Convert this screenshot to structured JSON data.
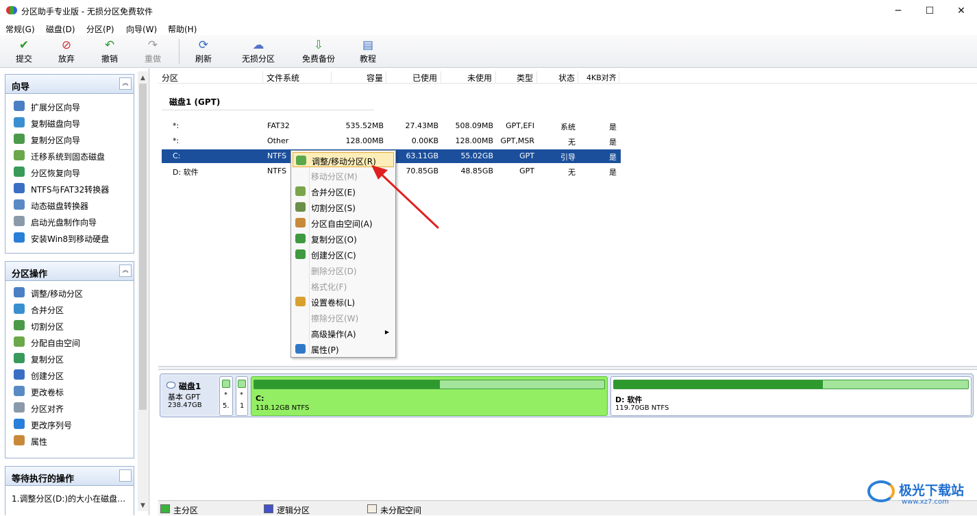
{
  "window": {
    "title": "分区助手专业版 - 无损分区免费软件",
    "controls": {
      "minimize": "─",
      "maximize": "☐",
      "close": "✕"
    }
  },
  "menu": [
    "常规(G)",
    "磁盘(D)",
    "分区(P)",
    "向导(W)",
    "帮助(H)"
  ],
  "toolbar": [
    {
      "label": "提交",
      "icon": "check-icon",
      "glyph": "✔",
      "color": "#2b9a2b"
    },
    {
      "label": "放弃",
      "icon": "discard-icon",
      "glyph": "⊘",
      "color": "#d23030"
    },
    {
      "label": "撤销",
      "icon": "undo-icon",
      "glyph": "↶",
      "color": "#2b9a2b"
    },
    {
      "label": "重做",
      "icon": "redo-icon",
      "glyph": "↷",
      "color": "#9a9a9a"
    },
    {
      "label": "刷新",
      "icon": "refresh-icon",
      "glyph": "⟳",
      "color": "#3a6fc4"
    },
    {
      "label": "无损分区",
      "icon": "lossless-partition-icon",
      "glyph": "☁",
      "color": "#5572c8"
    },
    {
      "label": "免费备份",
      "icon": "backup-icon",
      "glyph": "⇩",
      "color": "#2b9a2b"
    },
    {
      "label": "教程",
      "icon": "tutorial-icon",
      "glyph": "▤",
      "color": "#3a6fc4"
    }
  ],
  "wizard_panel": {
    "title": "向导",
    "items": [
      "扩展分区向导",
      "复制磁盘向导",
      "复制分区向导",
      "迁移系统到固态磁盘",
      "分区恢复向导",
      "NTFS与FAT32转换器",
      "动态磁盘转换器",
      "启动光盘制作向导",
      "安装Win8到移动硬盘"
    ]
  },
  "ops_panel": {
    "title": "分区操作",
    "items": [
      "调整/移动分区",
      "合并分区",
      "切割分区",
      "分配自由空间",
      "复制分区",
      "创建分区",
      "更改卷标",
      "分区对齐",
      "更改序列号",
      "属性"
    ]
  },
  "pending_panel": {
    "title": "等待执行的操作",
    "items": [
      "1.调整分区(D:)的大小在磁盘…"
    ]
  },
  "columns": [
    "分区",
    "文件系统",
    "容量",
    "已使用",
    "未使用",
    "类型",
    "状态",
    "4KB对齐"
  ],
  "disk_label": "磁盘1 (GPT)",
  "rows": [
    {
      "name": "*:",
      "fs": "FAT32",
      "cap": "535.52MB",
      "used": "27.43MB",
      "free": "508.09MB",
      "type": "GPT,EFI",
      "status": "系统",
      "align": "是"
    },
    {
      "name": "*:",
      "fs": "Other",
      "cap": "128.00MB",
      "used": "0.00KB",
      "free": "128.00MB",
      "type": "GPT,MSR",
      "status": "无",
      "align": "是"
    },
    {
      "name": "C:",
      "fs": "NTFS",
      "cap": "",
      "used": "63.11GB",
      "free": "55.02GB",
      "type": "GPT",
      "status": "引导",
      "align": "是"
    },
    {
      "name": "D: 软件",
      "fs": "NTFS",
      "cap": "",
      "used": "70.85GB",
      "free": "48.85GB",
      "type": "GPT",
      "status": "无",
      "align": "是"
    }
  ],
  "context_menu": [
    {
      "label": "调整/移动分区(R)",
      "enabled": true,
      "highlight": true,
      "color": "#5aa84a"
    },
    {
      "label": "移动分区(M)",
      "enabled": false,
      "color": ""
    },
    {
      "label": "合并分区(E)",
      "enabled": true,
      "color": "#7aa54a"
    },
    {
      "label": "切割分区(S)",
      "enabled": true,
      "color": "#6a8f4a"
    },
    {
      "label": "分区自由空间(A)",
      "enabled": true,
      "color": "#c88a3a"
    },
    {
      "label": "复制分区(O)",
      "enabled": true,
      "color": "#3f9a3f"
    },
    {
      "label": "创建分区(C)",
      "enabled": true,
      "color": "#3f9a3f"
    },
    {
      "label": "删除分区(D)",
      "enabled": false,
      "color": ""
    },
    {
      "label": "格式化(F)",
      "enabled": false,
      "color": ""
    },
    {
      "label": "设置卷标(L)",
      "enabled": true,
      "color": "#d8a030"
    },
    {
      "label": "擦除分区(W)",
      "enabled": false,
      "color": ""
    },
    {
      "label": "高级操作(A)",
      "enabled": true,
      "color": "",
      "submenu": true
    },
    {
      "label": "属性(P)",
      "enabled": true,
      "color": "#2f78c8"
    }
  ],
  "diskmap": {
    "name": "磁盘1",
    "kind": "基本 GPT",
    "size": "238.47GB",
    "small_parts": [
      {
        "top": "*",
        "bottom": "5."
      },
      {
        "top": "*",
        "bottom": "1"
      }
    ],
    "parts": [
      {
        "name": "C:",
        "size": "118.12GB NTFS",
        "used_fraction": 0.53,
        "selected": true
      },
      {
        "name": "D: 软件",
        "size": "119.70GB NTFS",
        "used_fraction": 0.59,
        "selected": false
      }
    ]
  },
  "legend": [
    {
      "label": "主分区",
      "color": "#3bb33b"
    },
    {
      "label": "逻辑分区",
      "color": "#4650c8"
    },
    {
      "label": "未分配空间",
      "color": "#f4eee2"
    }
  ],
  "watermark": {
    "text": "极光下载站",
    "url": "www.xz7.com"
  }
}
